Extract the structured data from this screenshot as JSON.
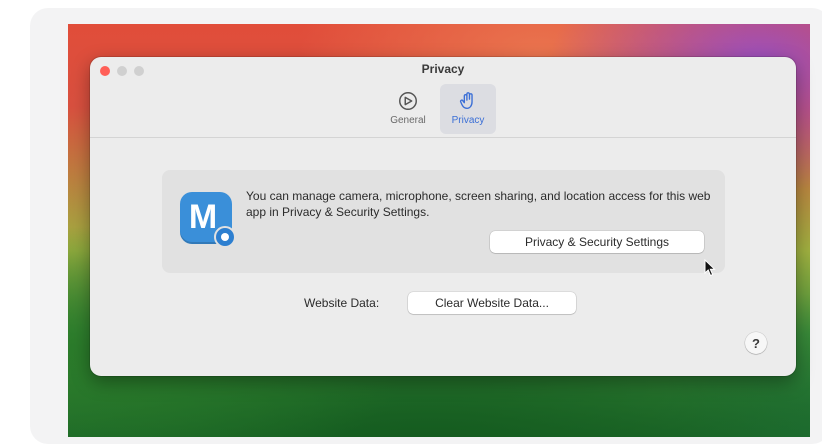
{
  "window": {
    "title": "Privacy"
  },
  "toolbar": {
    "tabs": [
      {
        "label": "General",
        "icon": "compass-icon",
        "selected": false
      },
      {
        "label": "Privacy",
        "icon": "hand-icon",
        "selected": true
      }
    ]
  },
  "privacy_panel": {
    "app_icon_letter": "M",
    "message": "You can manage camera, microphone, screen sharing, and location access for this web app in Privacy & Security Settings.",
    "settings_button_label": "Privacy & Security Settings"
  },
  "website_data": {
    "label": "Website Data:",
    "clear_button_label": "Clear Website Data..."
  },
  "help": {
    "label": "?"
  },
  "colors": {
    "accent": "#3b6fd6",
    "app_icon": "#3a8fd9",
    "close_light": "#ff5f57"
  }
}
